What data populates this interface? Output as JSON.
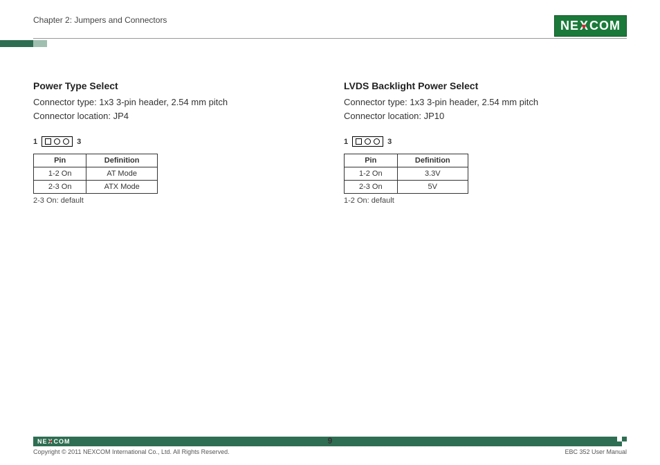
{
  "header": {
    "chapter": "Chapter 2: Jumpers and Connectors",
    "logo_text_1": "NE",
    "logo_text_x": "X",
    "logo_text_2": "COM"
  },
  "left": {
    "title": "Power Type Select",
    "connector_type": "Connector type: 1x3 3-pin header, 2.54 mm pitch",
    "connector_loc": "Connector location: JP4",
    "pin_left": "1",
    "pin_right": "3",
    "th_pin": "Pin",
    "th_def": "Definition",
    "rows": [
      {
        "pin": "1-2 On",
        "def": "AT Mode"
      },
      {
        "pin": "2-3 On",
        "def": "ATX Mode"
      }
    ],
    "note": "2-3 On: default"
  },
  "right": {
    "title": "LVDS Backlight Power Select",
    "connector_type": "Connector type: 1x3 3-pin header, 2.54 mm pitch",
    "connector_loc": "Connector location: JP10",
    "pin_left": "1",
    "pin_right": "3",
    "th_pin": "Pin",
    "th_def": "Definition",
    "rows": [
      {
        "pin": "1-2 On",
        "def": "3.3V"
      },
      {
        "pin": "2-3 On",
        "def": "5V"
      }
    ],
    "note": "1-2 On: default"
  },
  "footer": {
    "logo_text_1": "NE",
    "logo_text_x": "X",
    "logo_text_2": "COM",
    "copyright": "Copyright © 2011 NEXCOM International Co., Ltd. All Rights Reserved.",
    "page": "9",
    "doc": "EBC 352 User Manual"
  }
}
